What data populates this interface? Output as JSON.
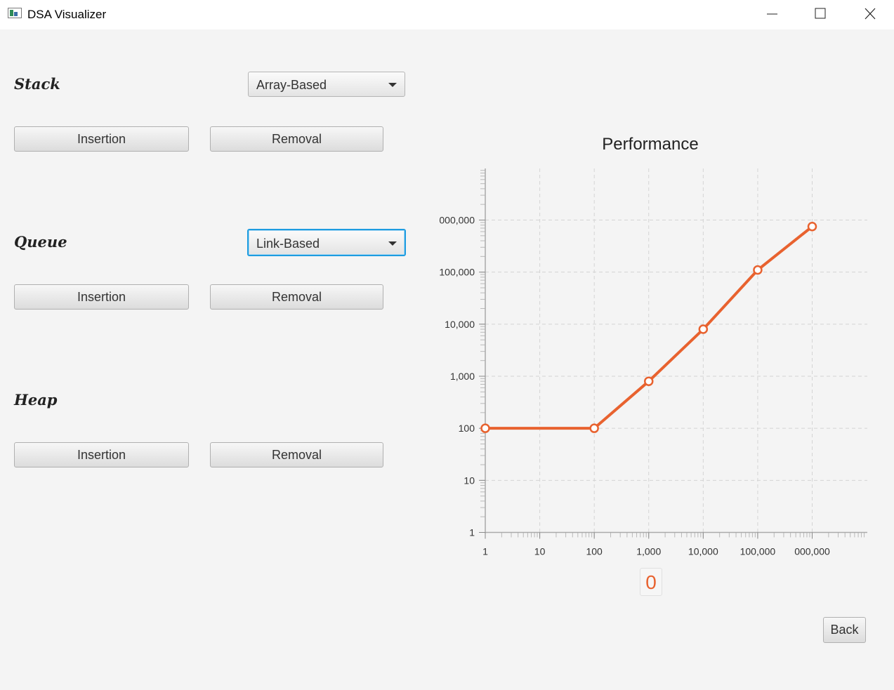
{
  "window": {
    "title": "DSA Visualizer",
    "minimize_icon": "minimize-icon",
    "maximize_icon": "maximize-icon",
    "close_icon": "close-icon"
  },
  "sections": {
    "stack": {
      "label": "Stack",
      "impl": "Array-Based",
      "insert": "Insertion",
      "remove": "Removal"
    },
    "queue": {
      "label": "Queue",
      "impl": "Link-Based",
      "insert": "Insertion",
      "remove": "Removal"
    },
    "heap": {
      "label": "Heap",
      "insert": "Insertion",
      "remove": "Removal"
    }
  },
  "counter": "0",
  "back_label": "Back",
  "colors": {
    "accent": "#e8622f",
    "focus": "#1e9ce0"
  },
  "chart_data": {
    "type": "line",
    "title": "Performance",
    "xlabel": "",
    "ylabel": "",
    "x_scale": "log",
    "y_scale": "log",
    "xlim": [
      1,
      1000000
    ],
    "ylim": [
      1,
      1000000
    ],
    "x_ticks": [
      1,
      10,
      100,
      1000,
      10000,
      100000,
      1000000
    ],
    "x_tick_labels": [
      "1",
      "10",
      "100",
      "1,000",
      "10,000",
      "100,000",
      "000,000"
    ],
    "y_ticks": [
      1,
      10,
      100,
      1000,
      10000,
      100000,
      1000000
    ],
    "y_tick_labels": [
      "1",
      "10",
      "100",
      "1,000",
      "10,000",
      "100,000",
      "000,000"
    ],
    "grid": true,
    "series": [
      {
        "color": "#e8622f",
        "x": [
          1,
          100,
          1000,
          10000,
          100000,
          1000000
        ],
        "y": [
          100,
          100,
          800,
          8000,
          110000,
          750000
        ]
      }
    ]
  }
}
